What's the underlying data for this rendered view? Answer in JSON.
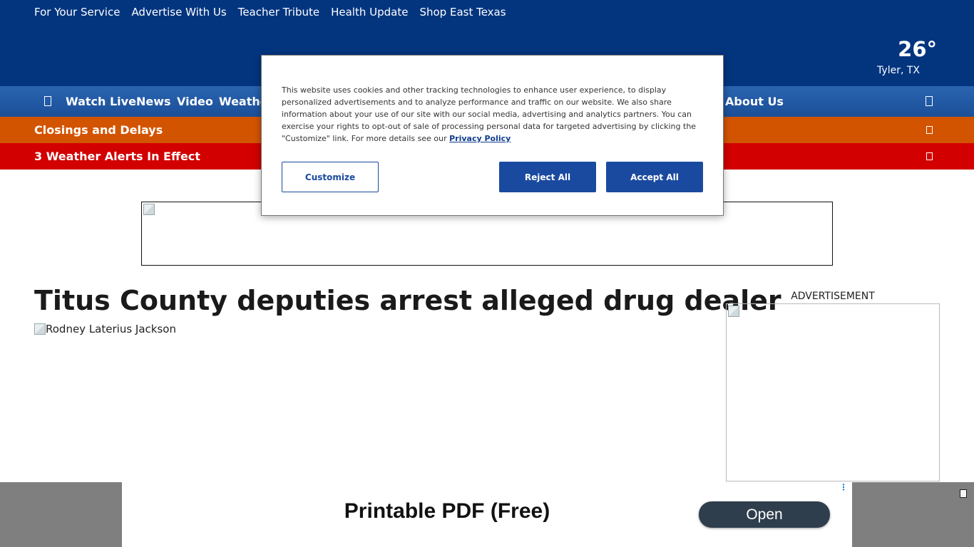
{
  "top_links": [
    "For Your Service",
    "Advertise With Us",
    "Teacher Tribute",
    "Health Update",
    "Shop East Texas"
  ],
  "weather": {
    "temperature": "26°",
    "location": "Tyler, TX"
  },
  "nav": {
    "items": [
      "Watch Live",
      "News",
      "Video",
      "Weathe",
      "About Us"
    ]
  },
  "closings_label": "Closings and Delays",
  "alerts_label": "3 Weather Alerts In Effect",
  "cookie": {
    "text": "This website uses cookies and other tracking technologies to enhance user experience, to display personalized advertisements and to analyze performance and traffic on our website. We also share information about your use of our site with our social media, advertising and analytics partners. You can exercise your rights to opt-out of sale of processing personal data for targeted advertising by clicking the \"Customize\" link. For more details see our ",
    "privacy_link": "Privacy Policy",
    "customize": "Customize",
    "reject": "Reject All",
    "accept": "Accept All"
  },
  "article": {
    "headline": "Titus County deputies arrest alleged drug dealer",
    "photo_alt": "Rodney Laterius Jackson"
  },
  "sidebar": {
    "ad_label": "ADVERTISEMENT"
  },
  "bottom_ad": {
    "title": "Printable PDF (Free)",
    "button": "Open"
  },
  "colors": {
    "header": "#03357f",
    "nav": "#1f56a3",
    "closings": "#d35400",
    "alerts": "#d20000",
    "button_primary": "#1a4aa0"
  },
  "icons": {
    "nav_left": "hamburger-menu-icon",
    "nav_right": "search-icon",
    "closings": "chevron-right-icon",
    "alerts": "chevron-right-icon",
    "bottom_close": "close-icon"
  }
}
